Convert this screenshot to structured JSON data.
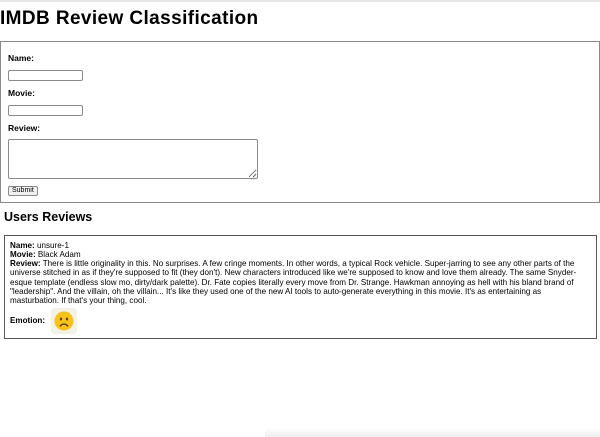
{
  "header": {
    "title": "IMDB Review Classification"
  },
  "form": {
    "name_label": "Name:",
    "movie_label": "Movie:",
    "review_label": "Review:",
    "name_value": "",
    "movie_value": "",
    "review_value": "",
    "submit_label": "Submit"
  },
  "reviews": {
    "title": "Users Reviews",
    "items": [
      {
        "name_label": "Name:",
        "name": "unsure-1",
        "movie_label": "Movie:",
        "movie": "Black Adam",
        "review_label": "Review:",
        "review": "There is little originality in this. No surprises. A few cringe moments. In other words, a typical Rock vehicle. Super-jarring to see any other parts of the universe stitched in as if they're supposed to fit (they don't). New characters introduced like we're supposed to know and love them already. The same Snyder-esque template (endless slow mo, dirty/dark palette). Dr. Fate copies literally every move from Dr. Strange. Hawkman annoying as hell with his bland brand of \"leadership\". And the villain, oh the villain... It's like they used one of the new AI tools to auto-generate everything in this movie. It's as entertaining as masturbation. If that's your thing, cool.",
        "emotion_label": "Emotion:",
        "emotion_icon": "frowning-face-icon"
      }
    ]
  },
  "colors": {
    "emoji_face": "#f7c21b",
    "emoji_features": "#5a3b12"
  }
}
